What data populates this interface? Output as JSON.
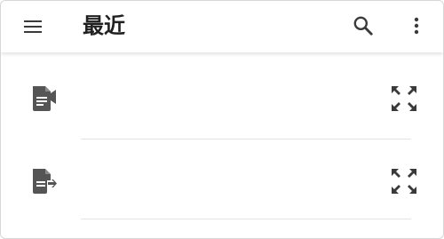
{
  "appbar": {
    "title": "最近",
    "menu_icon": "menu-icon",
    "search_icon": "search-icon",
    "more_icon": "more-vertical-icon"
  },
  "items": [
    {
      "icon": "video-document-icon",
      "action_icon": "expand-icon"
    },
    {
      "icon": "export-document-icon",
      "action_icon": "expand-icon"
    }
  ],
  "colors": {
    "icon": "#555555",
    "divider": "#e3e3e3",
    "text": "#202020"
  }
}
